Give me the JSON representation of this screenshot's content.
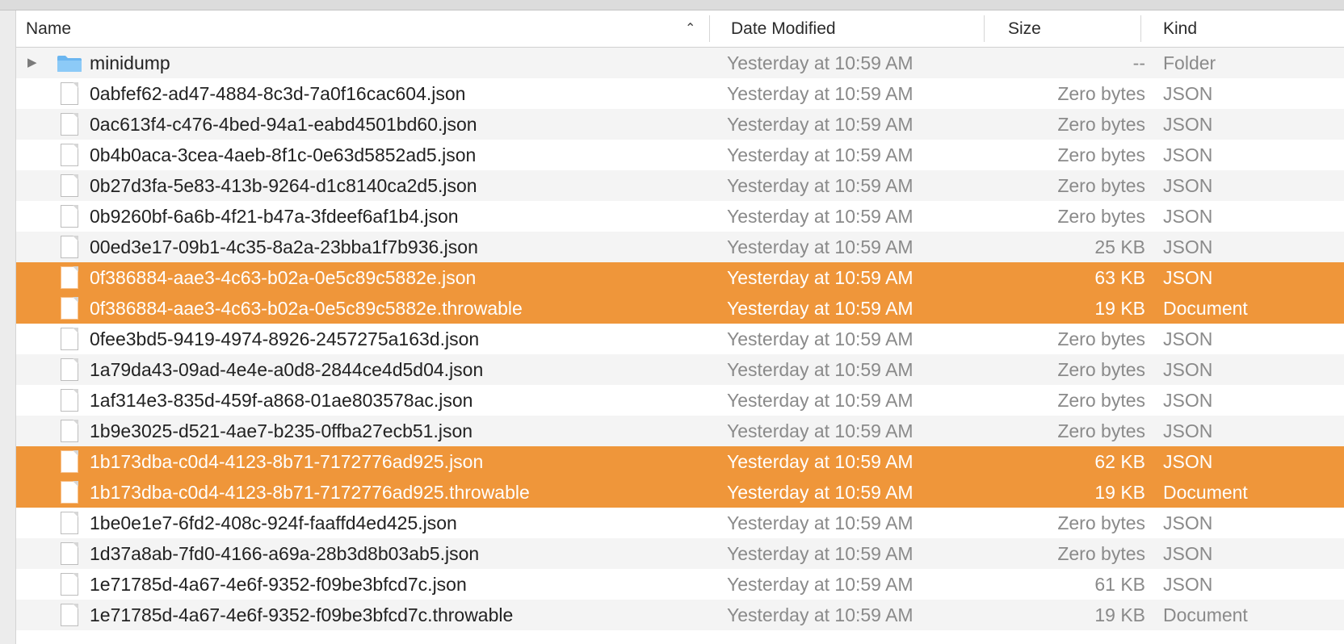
{
  "columns": {
    "name": "Name",
    "date": "Date Modified",
    "size": "Size",
    "kind": "Kind",
    "sort_indicator": "chevron-up-icon"
  },
  "colors": {
    "selection": "#ef963a",
    "folder": "#6bb6f0",
    "row_alt": "#f4f4f4"
  },
  "rows": [
    {
      "type": "folder",
      "name": "minidump",
      "date": "Yesterday at 10:59 AM",
      "size": "--",
      "kind": "Folder",
      "selected": false
    },
    {
      "type": "file",
      "name": "0abfef62-ad47-4884-8c3d-7a0f16cac604.json",
      "date": "Yesterday at 10:59 AM",
      "size": "Zero bytes",
      "kind": "JSON",
      "selected": false
    },
    {
      "type": "file",
      "name": "0ac613f4-c476-4bed-94a1-eabd4501bd60.json",
      "date": "Yesterday at 10:59 AM",
      "size": "Zero bytes",
      "kind": "JSON",
      "selected": false
    },
    {
      "type": "file",
      "name": "0b4b0aca-3cea-4aeb-8f1c-0e63d5852ad5.json",
      "date": "Yesterday at 10:59 AM",
      "size": "Zero bytes",
      "kind": "JSON",
      "selected": false
    },
    {
      "type": "file",
      "name": "0b27d3fa-5e83-413b-9264-d1c8140ca2d5.json",
      "date": "Yesterday at 10:59 AM",
      "size": "Zero bytes",
      "kind": "JSON",
      "selected": false
    },
    {
      "type": "file",
      "name": "0b9260bf-6a6b-4f21-b47a-3fdeef6af1b4.json",
      "date": "Yesterday at 10:59 AM",
      "size": "Zero bytes",
      "kind": "JSON",
      "selected": false
    },
    {
      "type": "file",
      "name": "00ed3e17-09b1-4c35-8a2a-23bba1f7b936.json",
      "date": "Yesterday at 10:59 AM",
      "size": "25 KB",
      "kind": "JSON",
      "selected": false
    },
    {
      "type": "file",
      "name": "0f386884-aae3-4c63-b02a-0e5c89c5882e.json",
      "date": "Yesterday at 10:59 AM",
      "size": "63 KB",
      "kind": "JSON",
      "selected": true
    },
    {
      "type": "file",
      "name": "0f386884-aae3-4c63-b02a-0e5c89c5882e.throwable",
      "date": "Yesterday at 10:59 AM",
      "size": "19 KB",
      "kind": "Document",
      "selected": true
    },
    {
      "type": "file",
      "name": "0fee3bd5-9419-4974-8926-2457275a163d.json",
      "date": "Yesterday at 10:59 AM",
      "size": "Zero bytes",
      "kind": "JSON",
      "selected": false
    },
    {
      "type": "file",
      "name": "1a79da43-09ad-4e4e-a0d8-2844ce4d5d04.json",
      "date": "Yesterday at 10:59 AM",
      "size": "Zero bytes",
      "kind": "JSON",
      "selected": false
    },
    {
      "type": "file",
      "name": "1af314e3-835d-459f-a868-01ae803578ac.json",
      "date": "Yesterday at 10:59 AM",
      "size": "Zero bytes",
      "kind": "JSON",
      "selected": false
    },
    {
      "type": "file",
      "name": "1b9e3025-d521-4ae7-b235-0ffba27ecb51.json",
      "date": "Yesterday at 10:59 AM",
      "size": "Zero bytes",
      "kind": "JSON",
      "selected": false
    },
    {
      "type": "file",
      "name": "1b173dba-c0d4-4123-8b71-7172776ad925.json",
      "date": "Yesterday at 10:59 AM",
      "size": "62 KB",
      "kind": "JSON",
      "selected": true
    },
    {
      "type": "file",
      "name": "1b173dba-c0d4-4123-8b71-7172776ad925.throwable",
      "date": "Yesterday at 10:59 AM",
      "size": "19 KB",
      "kind": "Document",
      "selected": true
    },
    {
      "type": "file",
      "name": "1be0e1e7-6fd2-408c-924f-faaffd4ed425.json",
      "date": "Yesterday at 10:59 AM",
      "size": "Zero bytes",
      "kind": "JSON",
      "selected": false
    },
    {
      "type": "file",
      "name": "1d37a8ab-7fd0-4166-a69a-28b3d8b03ab5.json",
      "date": "Yesterday at 10:59 AM",
      "size": "Zero bytes",
      "kind": "JSON",
      "selected": false
    },
    {
      "type": "file",
      "name": "1e71785d-4a67-4e6f-9352-f09be3bfcd7c.json",
      "date": "Yesterday at 10:59 AM",
      "size": "61 KB",
      "kind": "JSON",
      "selected": false
    },
    {
      "type": "file",
      "name": "1e71785d-4a67-4e6f-9352-f09be3bfcd7c.throwable",
      "date": "Yesterday at 10:59 AM",
      "size": "19 KB",
      "kind": "Document",
      "selected": false
    }
  ]
}
